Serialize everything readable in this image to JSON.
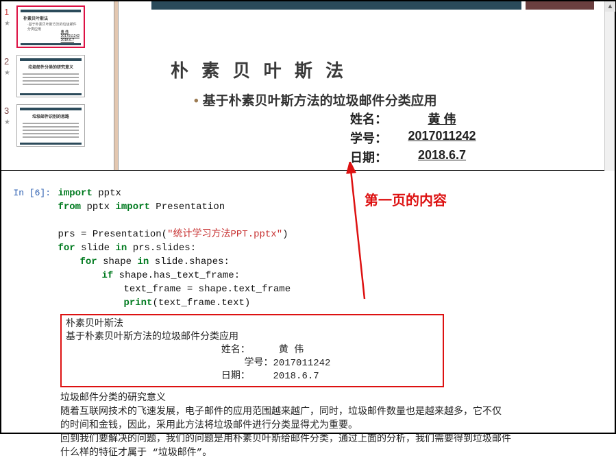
{
  "thumbs": {
    "n1": "1",
    "n2": "2",
    "n3": "3",
    "t2_title": "垃圾邮件分类的研究意义",
    "t3_title": "垃圾邮件识别的思路"
  },
  "slide": {
    "title": "朴 素 贝 叶 斯 法",
    "subtitle": "基于朴素贝叶斯方法的垃圾邮件分类应用",
    "name_label": "姓名：",
    "name_value": "黄  伟",
    "id_label": "学号：",
    "id_value": "2017011242",
    "date_label": "日期：",
    "date_value": "2018.6.7"
  },
  "jupyter": {
    "prompt": "In  [6]:",
    "code": {
      "l1_a": "import",
      "l1_b": " pptx",
      "l2_a": "from",
      "l2_b": " pptx ",
      "l2_c": "import",
      "l2_d": " Presentation",
      "l3_a": "prs = Presentation(",
      "l3_str": "\"统计学习方法PPT.pptx\"",
      "l3_b": ")",
      "l4_a": "for",
      "l4_b": " slide ",
      "l4_c": "in",
      "l4_d": " prs.slides:",
      "l5_a": "for",
      "l5_b": " shape ",
      "l5_c": "in",
      "l5_d": " slide.shapes:",
      "l6_a": "if",
      "l6_b": " shape.has_text_frame:",
      "l7": "text_frame = shape.text_frame",
      "l8_a": "print",
      "l8_b": "(text_frame.text)"
    }
  },
  "output_box": {
    "l1": "朴素贝叶斯法",
    "l2": "基于朴素贝叶斯方法的垃圾邮件分类应用",
    "l3": "                           姓名：     黄 伟",
    "l4": "                               学号：2017011242",
    "l5": "                           日期：    2018.6.7"
  },
  "output_rest": {
    "l1": "垃圾邮件分类的研究意义",
    "l2": "随着互联网技术的飞速发展，电子邮件的应用范围越来越广，同时，垃圾邮件数量也是越来越多，它不仅",
    "l3": "的时间和金钱，因此，采用此方法将垃圾邮件进行分类显得尤为重要。",
    "l4": "回到我们要解决的问题，我们的问题是用朴素贝叶斯给邮件分类，通过上面的分析，我们需要得到垃圾邮件",
    "l5": "什么样的特征才属于 “垃圾邮件”。"
  },
  "annotation": {
    "label": "第一页的内容"
  }
}
